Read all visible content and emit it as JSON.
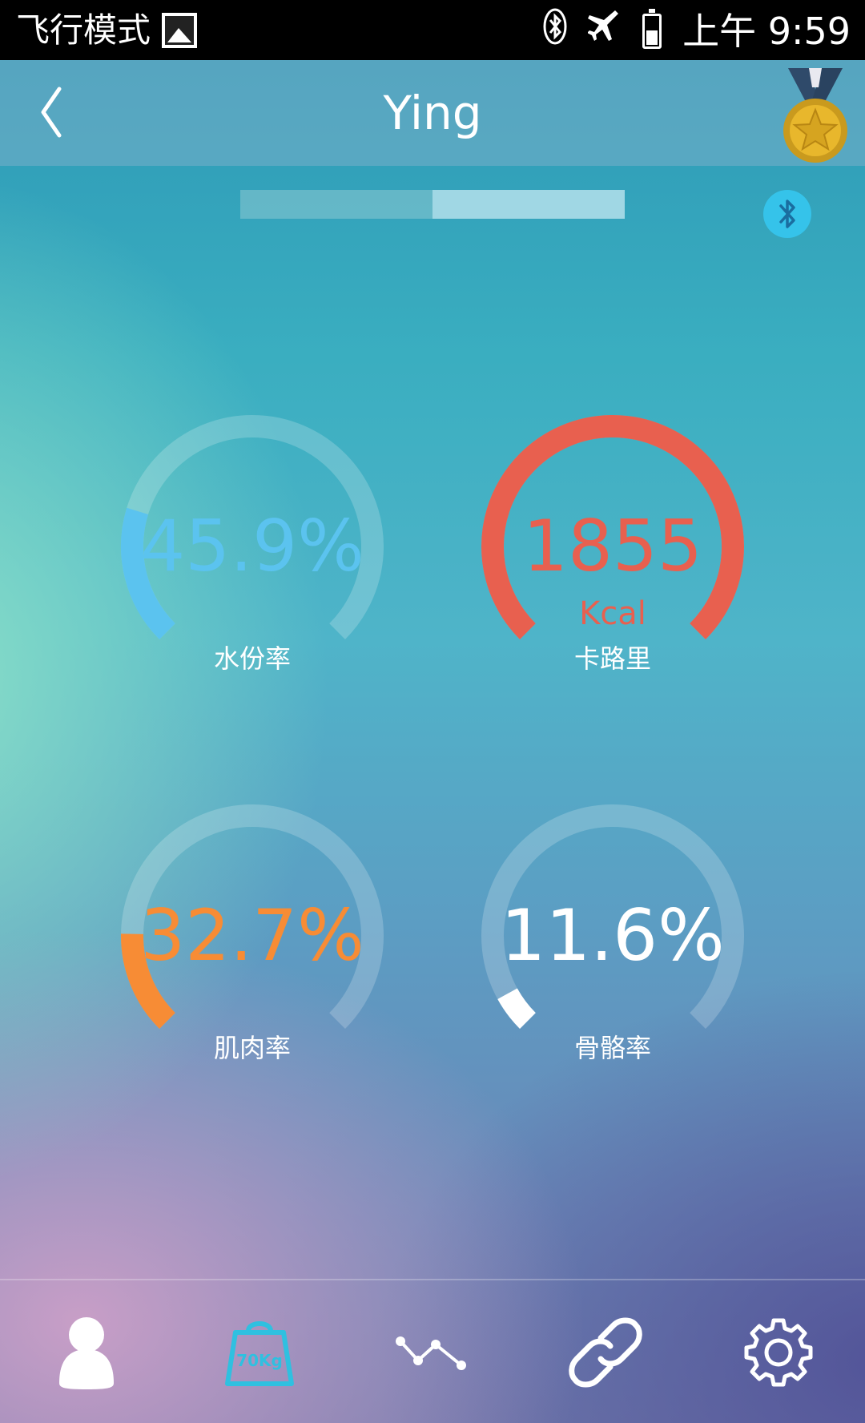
{
  "status_bar": {
    "mode_text": "飞行模式",
    "time": "上午 9:59"
  },
  "header": {
    "title": "Ying"
  },
  "tabs": {
    "segments": [
      "",
      ""
    ],
    "active_index": 1
  },
  "gauges": [
    {
      "id": "water",
      "value": "45.9%",
      "unit": "",
      "label": "水份率",
      "fraction": 0.23,
      "color": "#5bc3ef",
      "text_color": "#5bc3ef"
    },
    {
      "id": "calorie",
      "value": "1855",
      "unit": "Kcal",
      "label": "卡路里",
      "fraction": 1.0,
      "color": "#e8604f",
      "text_color": "#e8604f"
    },
    {
      "id": "muscle",
      "value": "32.7%",
      "unit": "",
      "label": "肌肉率",
      "fraction": 0.17,
      "color": "#f78c35",
      "text_color": "#f78c35"
    },
    {
      "id": "bone",
      "value": "11.6%",
      "unit": "",
      "label": "骨骼率",
      "fraction": 0.06,
      "color": "#ffffff",
      "text_color": "#ffffff"
    }
  ],
  "bottom_nav": {
    "items": [
      "person-icon",
      "scale-icon",
      "trend-icon",
      "link-icon",
      "gear-icon"
    ],
    "active_index": 1,
    "scale_text": "70Kg"
  },
  "colors": {
    "active_nav": "#2fc0e0",
    "bluetooth_button": "#35c3ea"
  }
}
